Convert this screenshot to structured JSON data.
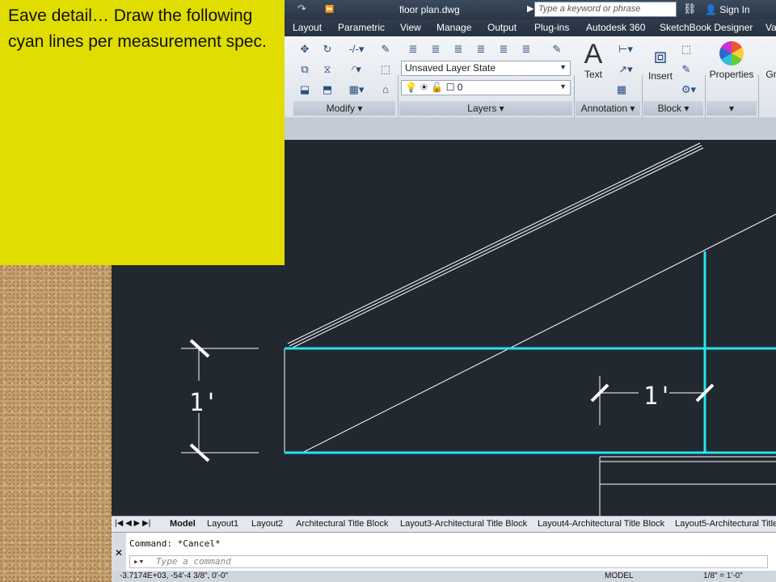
{
  "note": {
    "text": "Eave detail… Draw the following cyan lines per measurement spec."
  },
  "titlebar": {
    "quick_redo": "↷",
    "expand": "⏩",
    "file_title": "floor plan.dwg",
    "search_placeholder": "Type a keyword or phrase",
    "signin": "Sign In"
  },
  "tabs": [
    "Layout",
    "Parametric",
    "View",
    "Manage",
    "Output",
    "Plug-ins",
    "Autodesk 360",
    "SketchBook Designer",
    "Va"
  ],
  "ribbon": {
    "layer_state": "Unsaved Layer State",
    "layer_name": "0",
    "text_label": "Text",
    "insert_label": "Insert",
    "properties_label": "Properties",
    "group_label": "Gr",
    "panels": {
      "modify": "Modify",
      "layers": "Layers",
      "annotation": "Annotation",
      "block": "Block"
    }
  },
  "drawing": {
    "dim_vertical": "1'",
    "dim_horizontal": "1'",
    "colors": {
      "cyan": "#27e4ee",
      "white": "#ffffff",
      "background": "#212830"
    }
  },
  "layout_tabs": [
    "Model",
    "Layout1",
    "Layout2",
    "Architectural Title Block",
    "Layout3-Architectural Title Block",
    "Layout4-Architectural Title Block",
    "Layout5-Architectural Title"
  ],
  "command": {
    "history": "Command: *Cancel*",
    "placeholder": "Type a command"
  },
  "status": {
    "coords": "-3.7174E+03, -54'-4 3/8\", 0'-0\"",
    "model": "MODEL",
    "scale": "1/8\" = 1'-0\""
  }
}
